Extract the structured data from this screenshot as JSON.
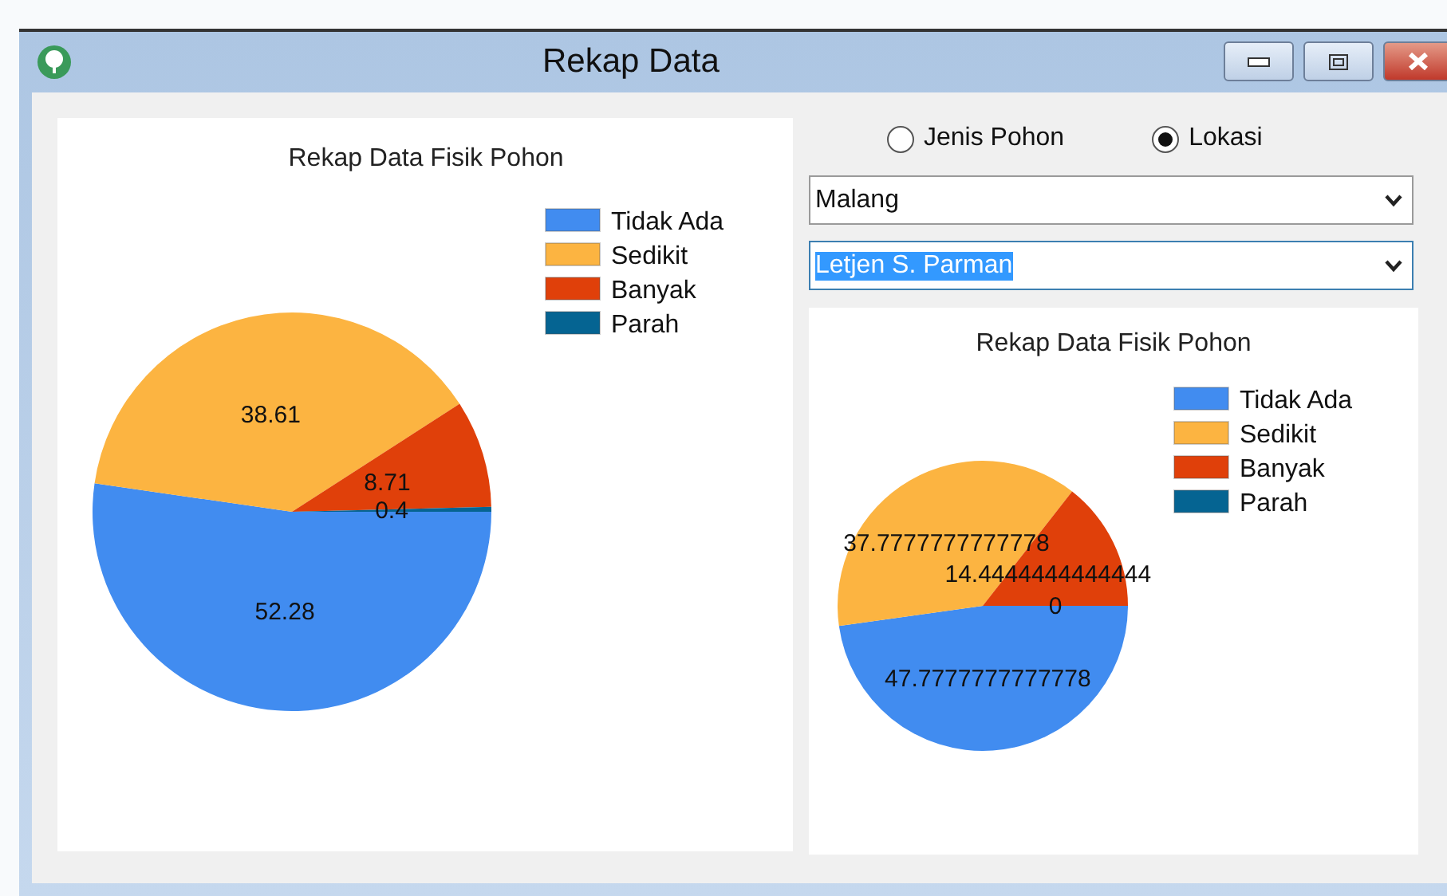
{
  "window": {
    "title": "Rekap Data"
  },
  "filter": {
    "options": [
      {
        "label": "Jenis Pohon",
        "selected": false
      },
      {
        "label": "Lokasi",
        "selected": true
      }
    ],
    "combos": [
      {
        "value": "Malang",
        "focused": false
      },
      {
        "value": "Letjen S. Parman",
        "focused": true
      }
    ]
  },
  "charts": [
    {
      "chart_data": {
        "type": "pie",
        "title": "Rekap Data Fisik Pohon",
        "categories": [
          "Tidak Ada",
          "Sedikit",
          "Banyak",
          "Parah"
        ],
        "colors": [
          "#418cf0",
          "#fcb441",
          "#e0400a",
          "#056492"
        ],
        "legend": "right",
        "series": [
          {
            "values": [
              52.28,
              38.61,
              8.71,
              0.4
            ]
          }
        ],
        "value_labels": [
          "52.28",
          "38.61",
          "8.71",
          "0.4"
        ]
      }
    },
    {
      "chart_data": {
        "type": "pie",
        "title": "Rekap Data Fisik Pohon",
        "categories": [
          "Tidak Ada",
          "Sedikit",
          "Banyak",
          "Parah"
        ],
        "colors": [
          "#418cf0",
          "#fcb441",
          "#e0400a",
          "#056492"
        ],
        "legend": "right",
        "series": [
          {
            "values": [
              47.7777777777778,
              37.7777777777778,
              14.4444444444444,
              0
            ]
          }
        ],
        "value_labels": [
          "47.7777777777778",
          "37.7777777777778",
          "14.4444444444444",
          "0"
        ]
      }
    }
  ]
}
